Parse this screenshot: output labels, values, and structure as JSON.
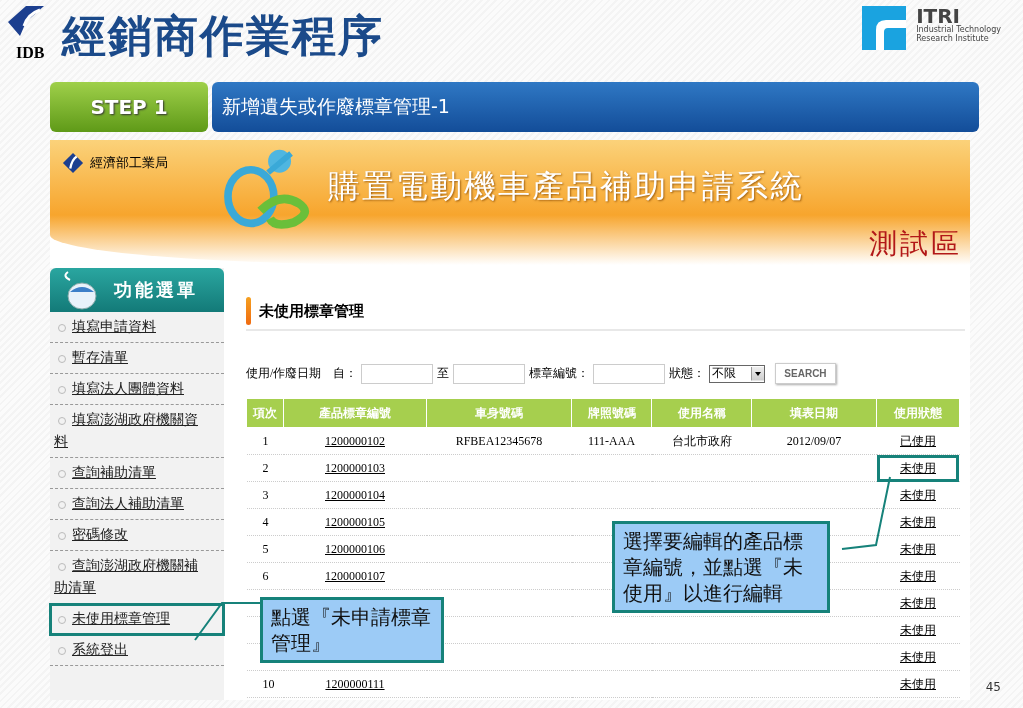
{
  "slide": {
    "logo_text": "IDB",
    "title": "經銷商作業程序",
    "itri": {
      "name": "ITRI",
      "subtitle_1": "Industrial Technology",
      "subtitle_2": "Research Institute"
    },
    "page_number": "45"
  },
  "step": {
    "label": "STEP 1",
    "title": "新增遺失或作廢標章管理-1"
  },
  "banner": {
    "agency": "經濟部工業局",
    "system_title": "購置電動機車產品補助申請系統",
    "test_badge": "測試區"
  },
  "sidebar": {
    "title": "功能選單",
    "items": [
      {
        "label": "填寫申請資料",
        "highlighted": false
      },
      {
        "label": "暫存清單",
        "highlighted": false
      },
      {
        "label": "填寫法人團體資料",
        "highlighted": false
      },
      {
        "label": "填寫澎湖政府機關資料",
        "highlighted": false
      },
      {
        "label": "查詢補助清單",
        "highlighted": false
      },
      {
        "label": "查詢法人補助清單",
        "highlighted": false
      },
      {
        "label": "密碼修改",
        "highlighted": false
      },
      {
        "label": "查詢澎湖政府機關補助清單",
        "highlighted": false
      },
      {
        "label": "未使用標章管理",
        "highlighted": true
      },
      {
        "label": "系統登出",
        "highlighted": false
      }
    ]
  },
  "main": {
    "heading": "未使用標章管理",
    "filters": {
      "date_label": "使用/作廢日期",
      "from_label": "自：",
      "to_label": "至",
      "code_label": "標章編號：",
      "status_label": "狀態：",
      "status_value": "不限",
      "search_button": "SEARCH"
    },
    "table": {
      "columns": [
        "項次",
        "產品標章編號",
        "車身號碼",
        "牌照號碼",
        "使用名稱",
        "填表日期",
        "使用狀態"
      ],
      "rows": [
        {
          "index": "1",
          "code": "1200000102",
          "body_number": "RFBEA12345678",
          "plate": "111-AAA",
          "user_name": "台北市政府",
          "date": "2012/09/07",
          "status": "已使用",
          "highlighted": false
        },
        {
          "index": "2",
          "code": "1200000103",
          "status": "未使用",
          "highlighted": true
        },
        {
          "index": "3",
          "code": "1200000104",
          "status": "未使用",
          "highlighted": false
        },
        {
          "index": "4",
          "code": "1200000105",
          "status": "未使用",
          "highlighted": false
        },
        {
          "index": "5",
          "code": "1200000106",
          "status": "未使用",
          "highlighted": false
        },
        {
          "index": "6",
          "code": "1200000107",
          "status": "未使用",
          "highlighted": false
        },
        {
          "status": "未使用",
          "highlighted": false
        },
        {
          "status": "未使用",
          "highlighted": false
        },
        {
          "status": "未使用",
          "highlighted": false
        },
        {
          "index": "10",
          "code": "1200000111",
          "status": "未使用",
          "highlighted": false
        }
      ]
    }
  },
  "callouts": [
    {
      "kind": "menu",
      "text": "點選『未申請標章管理』"
    },
    {
      "kind": "table",
      "text": "選擇要編輯的產品標章編號，並點選『未使用』以進行編輯"
    }
  ]
}
